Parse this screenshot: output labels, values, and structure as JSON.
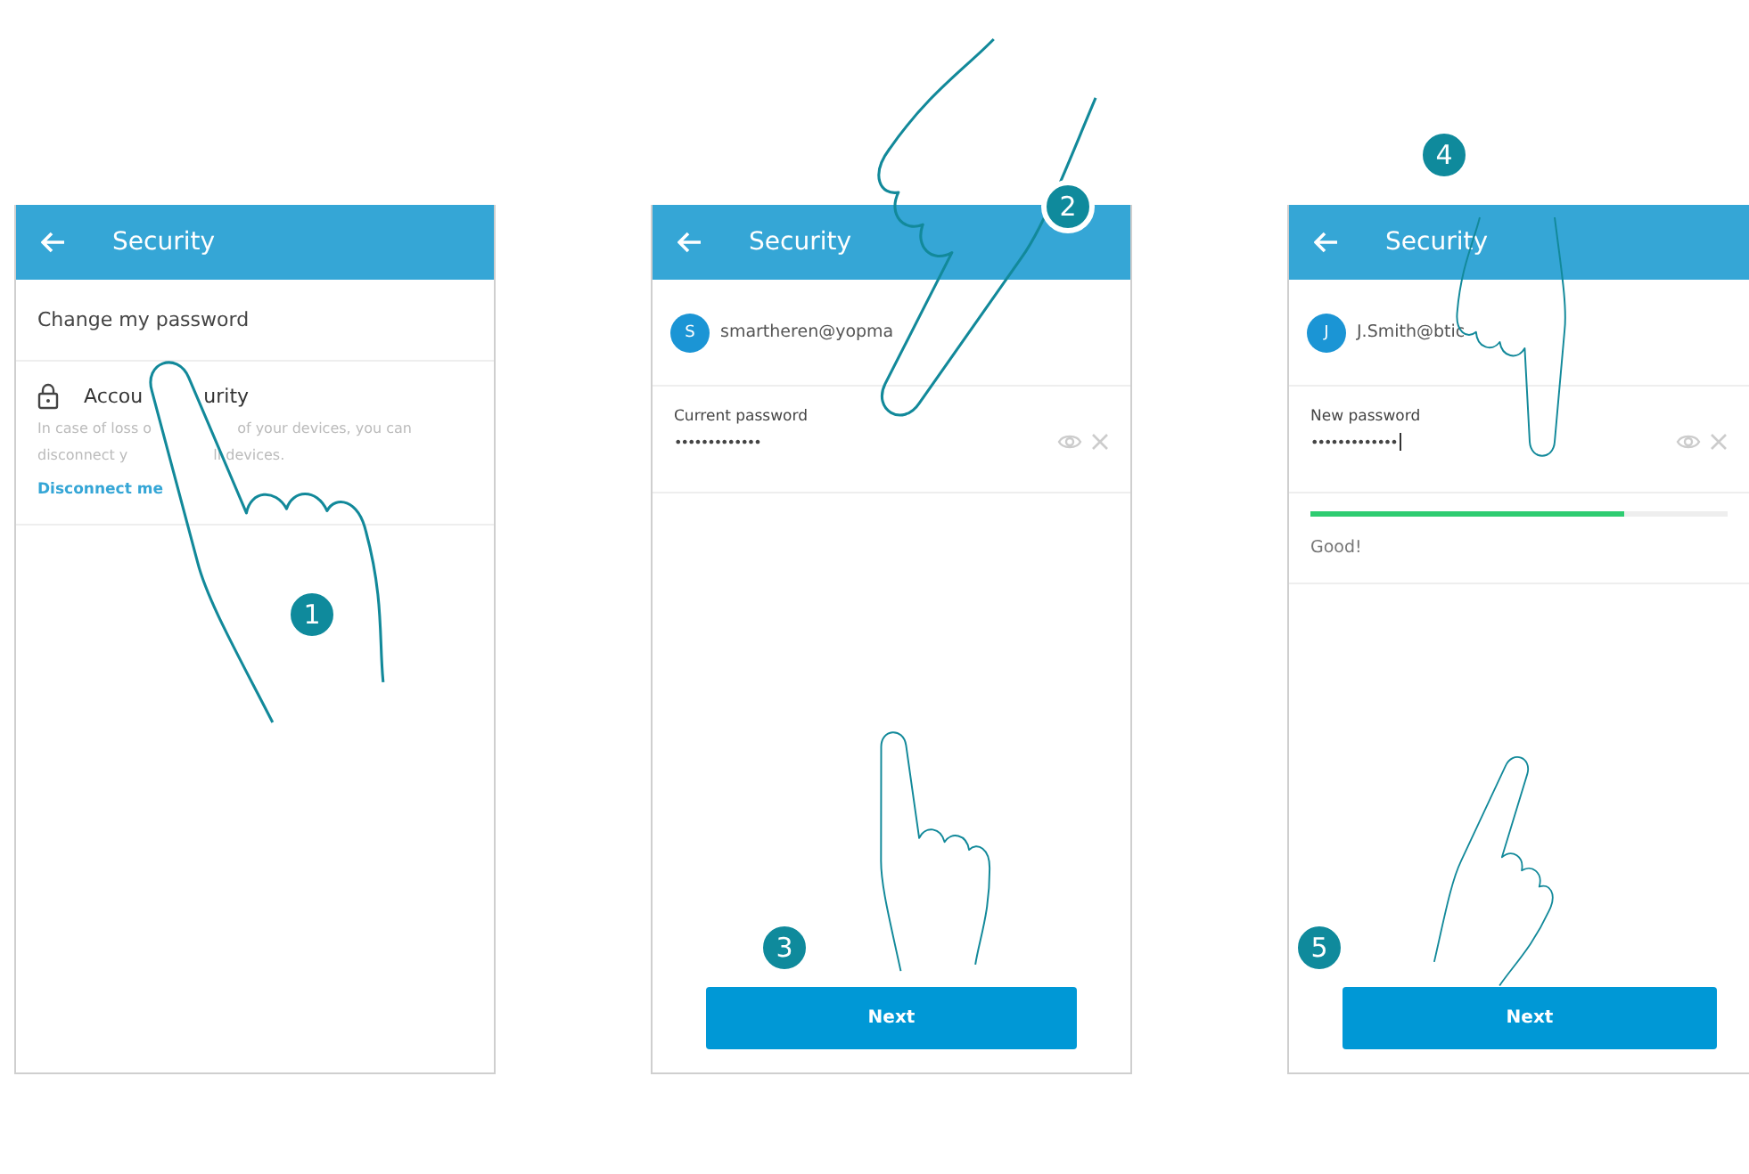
{
  "screens": [
    {
      "kind": "menu",
      "title": "Security",
      "option": "Change my password",
      "section_title_parts": [
        "Accou",
        "urity"
      ],
      "description_lines": [
        [
          "In case of loss o",
          "of your devices, you can"
        ],
        [
          "disconnect y",
          "ll devices."
        ]
      ],
      "link": "Disconnect me"
    },
    {
      "kind": "password",
      "title": "Security",
      "account": {
        "initial": "S",
        "email": "smartheren@yopma"
      },
      "field": {
        "label": "Current password",
        "value": "•••••••••••••",
        "cursor": false
      },
      "button": "Next"
    },
    {
      "kind": "password",
      "title": "Security",
      "account": {
        "initial": "J",
        "email": "J.Smith@btic"
      },
      "field": {
        "label": "New password",
        "value": "•••••••••••••",
        "cursor": true
      },
      "strength": {
        "level": 0.75,
        "label": "Good!"
      },
      "button": "Next"
    }
  ],
  "steps": [
    "1",
    "2",
    "3",
    "4",
    "5"
  ]
}
